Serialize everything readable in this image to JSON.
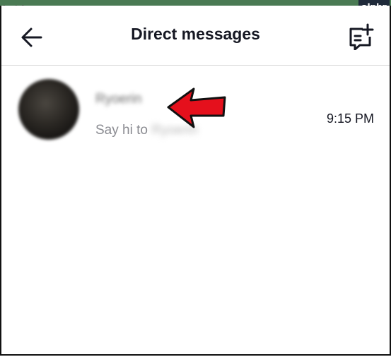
{
  "watermark": {
    "left_text": "ArabAq.com",
    "right_text": "alphr"
  },
  "header": {
    "title": "Direct messages",
    "back_icon": "arrow-left-icon",
    "compose_icon": "new-message-icon"
  },
  "conversations": [
    {
      "name": "Ryoerin",
      "preview_prefix": "Say hi to ",
      "preview_name": "Ryoerin",
      "time": "9:15 PM"
    }
  ],
  "colors": {
    "annotation_arrow": "#e5101c",
    "title_text": "#161823",
    "secondary_text": "#8a8b91"
  }
}
